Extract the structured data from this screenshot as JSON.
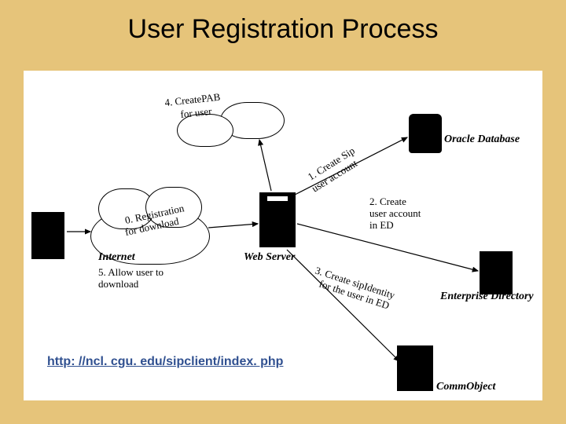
{
  "title": "User Registration Process",
  "url": "http: //ncl. cgu. edu/sipclient/index. php",
  "nodes": {
    "oracle": "Oracle Database",
    "webserver": "Web Server",
    "enterprise": "Enterprise Directory",
    "commobject": "CommObject",
    "internet": "Internet"
  },
  "steps": {
    "s0a": "0. Registration",
    "s0b": "for download",
    "s1a": "1. Create Sip",
    "s1b": "user account",
    "s2a": "2. Create",
    "s2b": "user account",
    "s2c": "in ED",
    "s3a": "3. Create sipIdentity",
    "s3b": "for the user in ED",
    "s4a": "4. CreatePAB",
    "s4b": "for user",
    "s5a": "5. Allow user to",
    "s5b": "download"
  }
}
